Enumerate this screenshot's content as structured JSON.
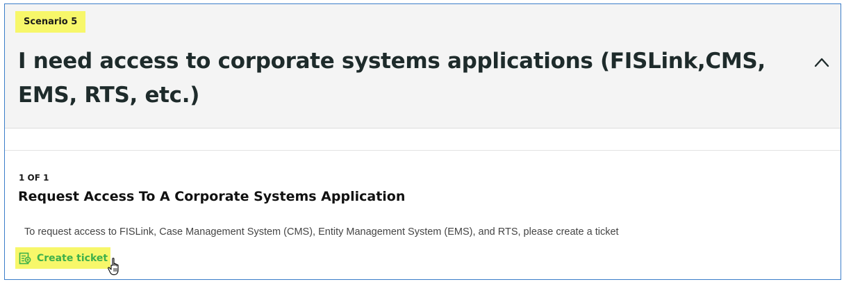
{
  "scenario": {
    "badge": "Scenario 5"
  },
  "header": {
    "title": "I need access to corporate systems applications (FISLink,CMS, EMS, RTS, etc.)",
    "collapse_icon": "chevron-up-icon"
  },
  "item": {
    "count": "1 OF 1",
    "title": "Request Access To A Corporate Systems Application",
    "description": "To request access to FISLink, Case Management System (CMS), Entity Management System (EMS), and RTS, please create a ticket",
    "action": {
      "label": "Create ticket",
      "icon": "ticket-icon"
    }
  },
  "colors": {
    "highlight": "#f7f76a",
    "accent_green": "#3db04a",
    "frame_border": "#3a7dc9",
    "header_bg": "#f4f4f4"
  }
}
